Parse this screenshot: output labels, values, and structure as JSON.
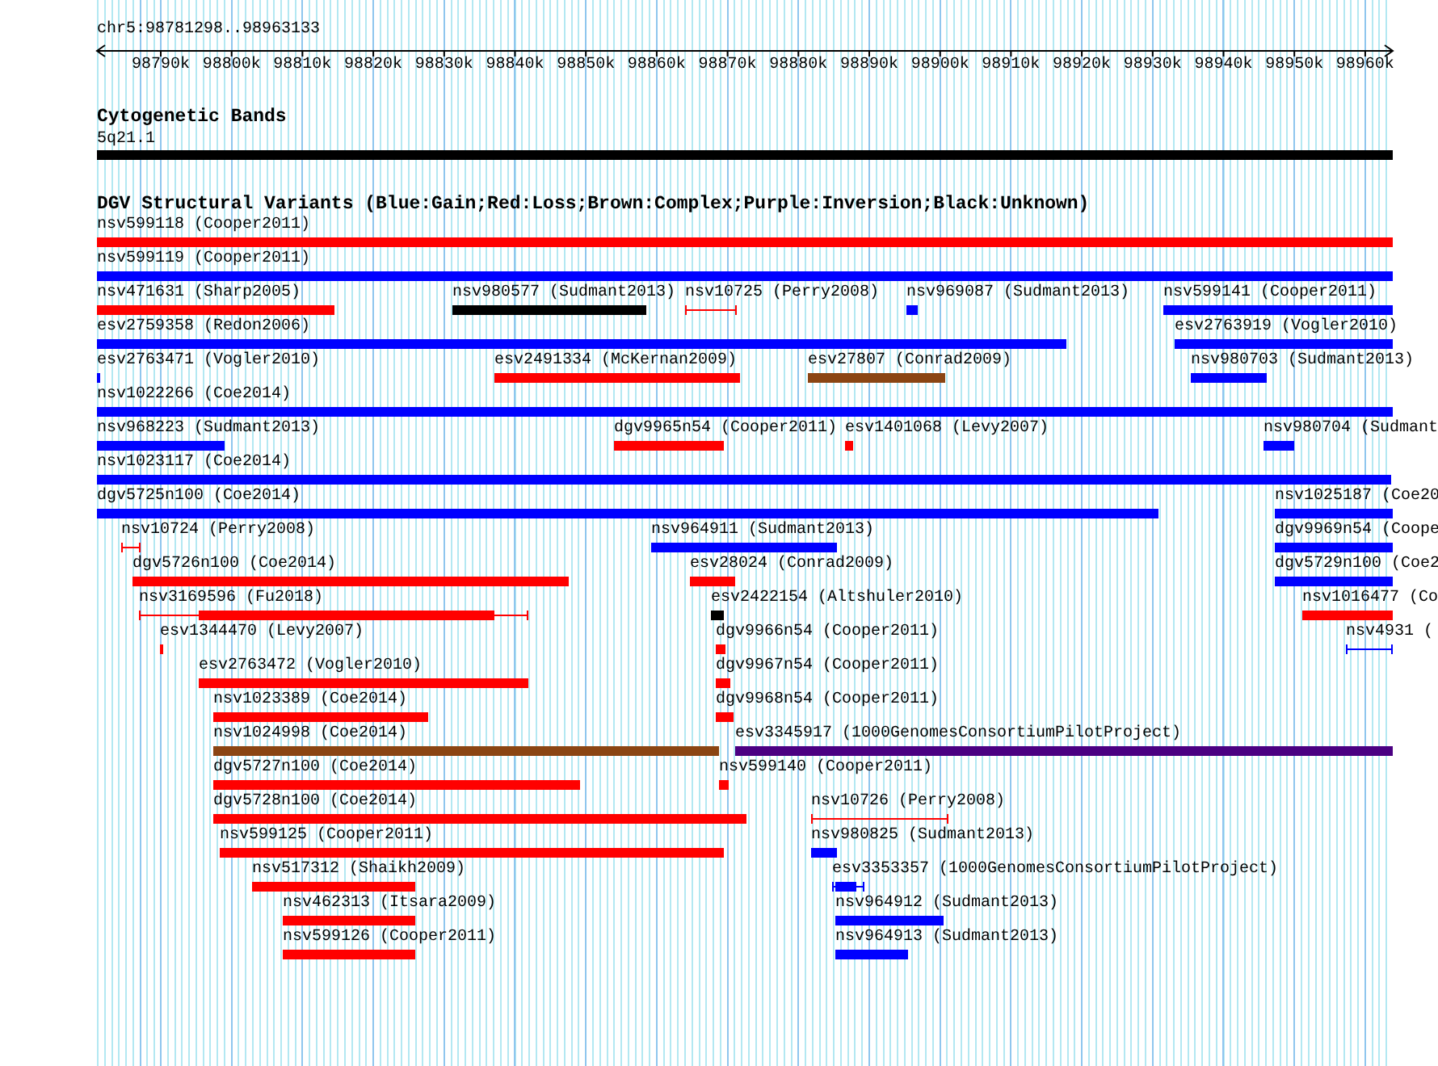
{
  "ruler": {
    "position": "chr5:98781298..98963133",
    "ticks": [
      "98790k",
      "98800k",
      "98810k",
      "98820k",
      "98830k",
      "98840k",
      "98850k",
      "98860k",
      "98870k",
      "98880k",
      "98890k",
      "98900k",
      "98910k",
      "98920k",
      "98930k",
      "98940k",
      "98950k",
      "98960k"
    ]
  },
  "cytogenetic_bands": {
    "title": "Cytogenetic Bands",
    "bands": [
      {
        "label": "5q21.1",
        "color": "#000000",
        "kind": "box"
      }
    ]
  },
  "structural_variants": {
    "title": "DGV Structural Variants (Blue:Gain;Red:Loss;Brown:Complex;Purple:Inversion;Black:Unknown)",
    "rows": [
      {
        "features": [
          {
            "label": "nsv599118 (Cooper2011)",
            "color": "#ff0000",
            "kind": "box"
          }
        ]
      },
      {
        "features": [
          {
            "label": "nsv599119 (Cooper2011)",
            "color": "#0000ff",
            "kind": "box"
          }
        ]
      },
      {
        "features": [
          {
            "label": "nsv471631 (Sharp2005)",
            "color": "#ff0000",
            "kind": "box"
          },
          {
            "label": "nsv980577 (Sudmant2013)",
            "color": "#000000",
            "kind": "box"
          },
          {
            "label": "nsv10725 (Perry2008)",
            "color": "#ff0000",
            "kind": "span"
          },
          {
            "label": "nsv969087 (Sudmant2013)",
            "color": "#0000ff",
            "kind": "box"
          },
          {
            "label": "nsv599141 (Cooper2011)",
            "color": "#0000ff",
            "kind": "box"
          }
        ]
      },
      {
        "features": [
          {
            "label": "esv2759358 (Redon2006)",
            "color": "#0000ff",
            "kind": "box"
          },
          {
            "label": "esv2763919 (Vogler2010)",
            "color": "#0000ff",
            "kind": "box"
          }
        ]
      },
      {
        "features": [
          {
            "label": "esv2763471 (Vogler2010)",
            "color": "#0000ff",
            "kind": "box"
          },
          {
            "label": "esv2491334 (McKernan2009)",
            "color": "#ff0000",
            "kind": "box"
          },
          {
            "label": "esv27807 (Conrad2009)",
            "color": "#8b4513",
            "kind": "box"
          },
          {
            "label": "nsv980703 (Sudmant2013)",
            "color": "#0000ff",
            "kind": "box"
          }
        ]
      },
      {
        "features": [
          {
            "label": "nsv1022266 (Coe2014)",
            "color": "#0000ff",
            "kind": "box"
          }
        ]
      },
      {
        "features": [
          {
            "label": "nsv968223 (Sudmant2013)",
            "color": "#0000ff",
            "kind": "box"
          },
          {
            "label": "dgv9965n54 (Cooper2011)",
            "color": "#ff0000",
            "kind": "box"
          },
          {
            "label": "esv1401068 (Levy2007)",
            "color": "#ff0000",
            "kind": "box"
          },
          {
            "label": "nsv980704 (Sudmant",
            "color": "#0000ff",
            "kind": "box"
          }
        ]
      },
      {
        "features": [
          {
            "label": "nsv1023117 (Coe2014)",
            "color": "#0000ff",
            "kind": "box"
          }
        ]
      },
      {
        "features": [
          {
            "label": "dgv5725n100 (Coe2014)",
            "color": "#0000ff",
            "kind": "box"
          },
          {
            "label": "nsv1025187 (Coe20",
            "color": "#0000ff",
            "kind": "box"
          }
        ]
      },
      {
        "features": [
          {
            "label": "nsv10724 (Perry2008)",
            "color": "#ff0000",
            "kind": "span"
          },
          {
            "label": "nsv964911 (Sudmant2013)",
            "color": "#0000ff",
            "kind": "box"
          },
          {
            "label": "dgv9969n54 (Coope",
            "color": "#0000ff",
            "kind": "box"
          }
        ]
      },
      {
        "features": [
          {
            "label": "dgv5726n100 (Coe2014)",
            "color": "#ff0000",
            "kind": "box"
          },
          {
            "label": "esv28024 (Conrad2009)",
            "color": "#ff0000",
            "kind": "box"
          },
          {
            "label": "dgv5729n100 (Coe2",
            "color": "#0000ff",
            "kind": "box"
          }
        ]
      },
      {
        "features": [
          {
            "label": "nsv3169596 (Fu2018)",
            "color": "#ff0000",
            "kind": "span_box"
          },
          {
            "label": "esv2422154 (Altshuler2010)",
            "color": "#000000",
            "kind": "box"
          },
          {
            "label": "nsv1016477 (Co",
            "color": "#ff0000",
            "kind": "box"
          }
        ]
      },
      {
        "features": [
          {
            "label": "esv1344470 (Levy2007)",
            "color": "#ff0000",
            "kind": "box"
          },
          {
            "label": "dgv9966n54 (Cooper2011)",
            "color": "#ff0000",
            "kind": "box"
          },
          {
            "label": "nsv4931 (",
            "color": "#0000ff",
            "kind": "span"
          }
        ]
      },
      {
        "features": [
          {
            "label": "esv2763472 (Vogler2010)",
            "color": "#ff0000",
            "kind": "box"
          },
          {
            "label": "dgv9967n54 (Cooper2011)",
            "color": "#ff0000",
            "kind": "box"
          }
        ]
      },
      {
        "features": [
          {
            "label": "nsv1023389 (Coe2014)",
            "color": "#ff0000",
            "kind": "box"
          },
          {
            "label": "dgv9968n54 (Cooper2011)",
            "color": "#ff0000",
            "kind": "box"
          }
        ]
      },
      {
        "features": [
          {
            "label": "nsv1024998 (Coe2014)",
            "color": "#8b4513",
            "kind": "box"
          },
          {
            "label": "esv3345917 (1000GenomesConsortiumPilotProject)",
            "color": "#4b0082",
            "kind": "box"
          }
        ]
      },
      {
        "features": [
          {
            "label": "dgv5727n100 (Coe2014)",
            "color": "#ff0000",
            "kind": "box"
          },
          {
            "label": "nsv599140 (Cooper2011)",
            "color": "#ff0000",
            "kind": "box"
          }
        ]
      },
      {
        "features": [
          {
            "label": "dgv5728n100 (Coe2014)",
            "color": "#ff0000",
            "kind": "box"
          },
          {
            "label": "nsv10726 (Perry2008)",
            "color": "#ff0000",
            "kind": "span"
          }
        ]
      },
      {
        "features": [
          {
            "label": "nsv599125 (Cooper2011)",
            "color": "#ff0000",
            "kind": "box"
          },
          {
            "label": "nsv980825 (Sudmant2013)",
            "color": "#0000ff",
            "kind": "box"
          }
        ]
      },
      {
        "features": [
          {
            "label": "nsv517312 (Shaikh2009)",
            "color": "#ff0000",
            "kind": "box"
          },
          {
            "label": "esv3353357 (1000GenomesConsortiumPilotProject)",
            "color": "#0000ff",
            "kind": "span_box"
          }
        ]
      },
      {
        "features": [
          {
            "label": "nsv462313 (Itsara2009)",
            "color": "#ff0000",
            "kind": "box"
          },
          {
            "label": "nsv964912 (Sudmant2013)",
            "color": "#0000ff",
            "kind": "box"
          }
        ]
      },
      {
        "features": [
          {
            "label": "nsv599126 (Cooper2011)",
            "color": "#ff0000",
            "kind": "box"
          },
          {
            "label": "nsv964913 (Sudmant2013)",
            "color": "#0000ff",
            "kind": "box"
          }
        ]
      }
    ]
  }
}
